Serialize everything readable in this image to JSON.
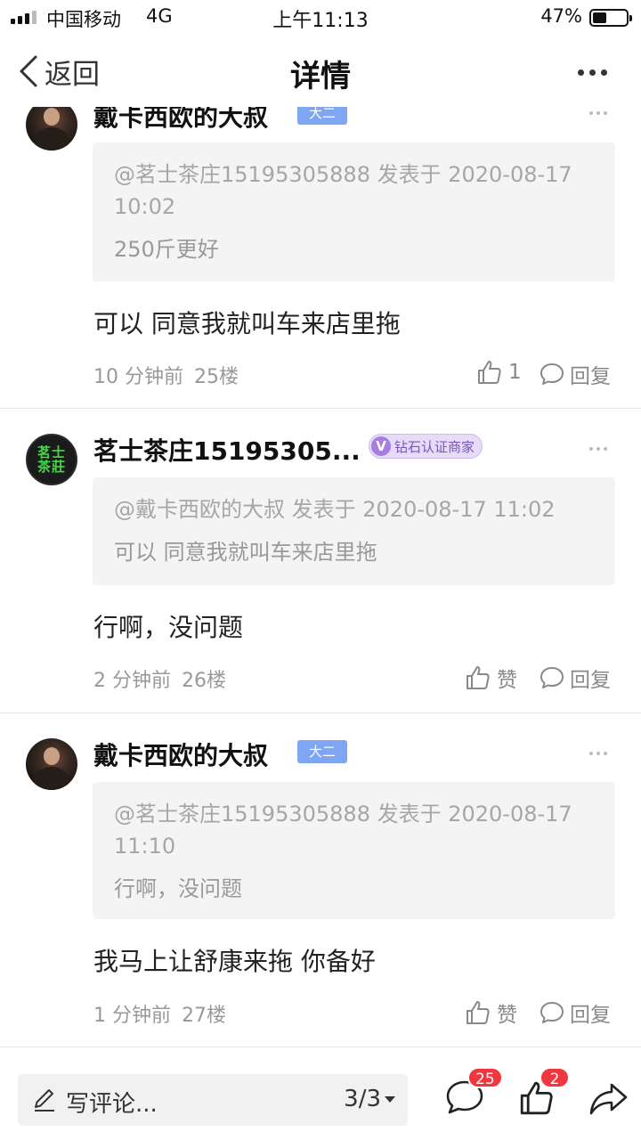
{
  "status_bar": {
    "carrier": "中国移动",
    "network": "4G",
    "time": "上午11:13",
    "battery_percent_text": "47%",
    "battery_level": 0.47
  },
  "nav": {
    "back_label": "返回",
    "title": "详情"
  },
  "posts": [
    {
      "author": "戴卡西欧的大叔",
      "level_badge": "大二",
      "quote_meta": "@茗士茶庄15195305888 发表于 2020-08-17 10:02",
      "quote_text": "250斤更好",
      "text": "可以 同意我就叫车来店里拖",
      "time_ago": "10 分钟前",
      "floor": "25楼",
      "like_label": "1",
      "reply_label": "回复"
    },
    {
      "author": "茗士茶庄15195305...",
      "avatar_text": [
        "茗士",
        "茶莊"
      ],
      "vip_badge": "钻石认证商家",
      "vip_mark": "V",
      "quote_meta": "@戴卡西欧的大叔 发表于 2020-08-17 11:02",
      "quote_text": "可以 同意我就叫车来店里拖",
      "text": "行啊，没问题",
      "time_ago": "2 分钟前",
      "floor": "26楼",
      "like_label": "赞",
      "reply_label": "回复"
    },
    {
      "author": "戴卡西欧的大叔",
      "level_badge": "大二",
      "quote_meta": "@茗士茶庄15195305888 发表于 2020-08-17 11:10",
      "quote_text": "行啊，没问题",
      "text": "我马上让舒康来拖 你备好",
      "time_ago": "1 分钟前",
      "floor": "27楼",
      "like_label": "赞",
      "reply_label": "回复"
    }
  ],
  "bottom_bar": {
    "comment_placeholder": "写评论...",
    "page_indicator": "3/3",
    "comment_count": "25",
    "like_count": "2"
  },
  "icons": {
    "back": "chevron-left-icon",
    "more": "more-dots-icon",
    "like": "thumbs-up-icon",
    "reply": "speech-bubble-icon",
    "pen": "pen-icon",
    "share": "share-arrow-icon"
  },
  "colors": {
    "level_badge": "#7ea6f2",
    "vip_badge": "#a77ddf",
    "count_badge": "#f0373f"
  }
}
